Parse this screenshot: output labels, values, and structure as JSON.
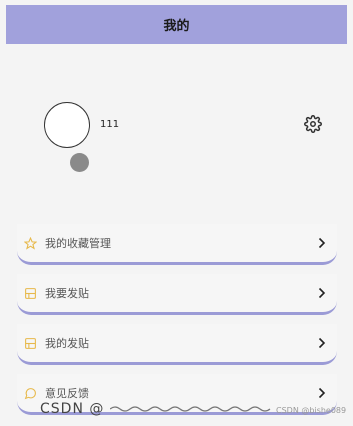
{
  "header": {
    "title": "我的"
  },
  "profile": {
    "username": "111",
    "settings_icon": "gear-icon"
  },
  "menu": [
    {
      "label": "我的收藏管理",
      "icon": "star-icon"
    },
    {
      "label": "我要发贴",
      "icon": "post-icon"
    },
    {
      "label": "我的发贴",
      "icon": "post-icon"
    },
    {
      "label": "意见反馈",
      "icon": "feedback-icon"
    }
  ],
  "watermark": {
    "left": "CSDN @",
    "right": "CSDN @bishe089"
  },
  "colors": {
    "accent": "#a1a1dc",
    "icon_yellow": "#e7b94b",
    "underline": "#9b9bd6"
  }
}
